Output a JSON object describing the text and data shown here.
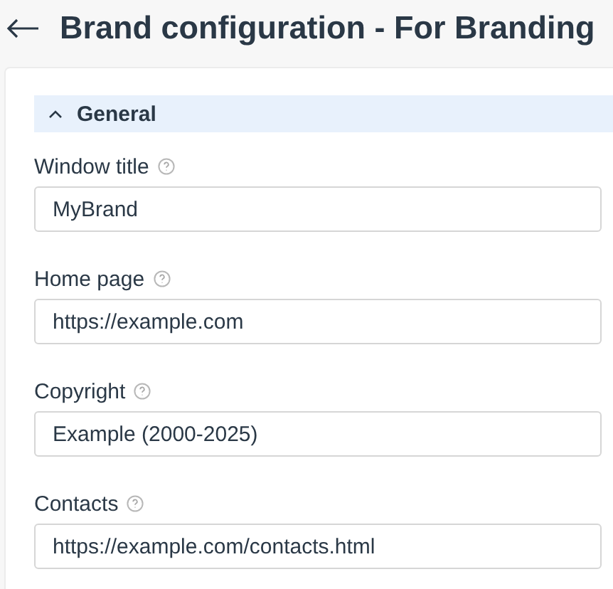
{
  "header": {
    "title": "Brand configuration - For Branding"
  },
  "section": {
    "title": "General",
    "expanded": true,
    "fields": [
      {
        "label": "Window title",
        "value": "MyBrand"
      },
      {
        "label": "Home page",
        "value": "https://example.com"
      },
      {
        "label": "Copyright",
        "value": "Example (2000-2025)"
      },
      {
        "label": "Contacts",
        "value": "https://example.com/contacts.html"
      }
    ]
  }
}
